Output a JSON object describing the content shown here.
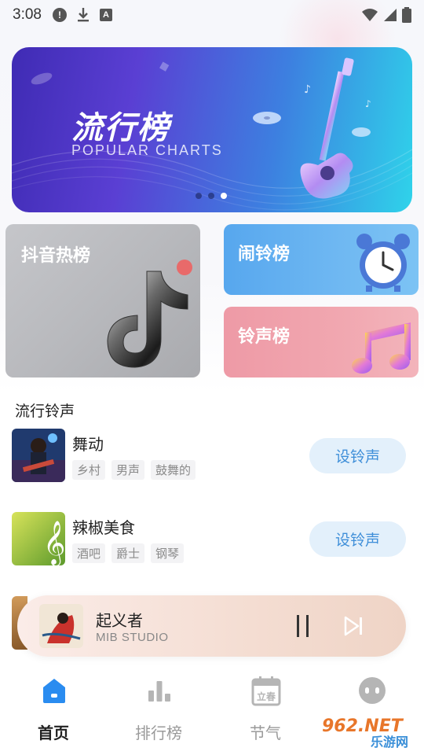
{
  "status_bar": {
    "time": "3:08",
    "icons": [
      "alert-icon",
      "download-icon",
      "a-icon",
      "wifi-icon",
      "signal-icon",
      "battery-icon"
    ],
    "a_glyph": "A",
    "alert_glyph": "!"
  },
  "banner": {
    "title": "流行榜",
    "subtitle": "POPULAR CHARTS",
    "carousel_pages": 3,
    "active_page": 3
  },
  "categories": {
    "douyin": "抖音热榜",
    "alarm": "闹铃榜",
    "ring": "铃声榜"
  },
  "section": {
    "title": "流行铃声"
  },
  "songs": [
    {
      "name": "舞动",
      "tags": [
        "乡村",
        "男声",
        "鼓舞的"
      ],
      "action": "设铃声"
    },
    {
      "name": "辣椒美食",
      "tags": [
        "酒吧",
        "爵士",
        "钢琴"
      ],
      "action": "设铃声"
    }
  ],
  "player": {
    "title": "起义者",
    "artist": "MIB STUDIO",
    "state": "playing"
  },
  "nav": {
    "items": [
      {
        "label": "首页",
        "icon": "home-icon",
        "active": true
      },
      {
        "label": "排行榜",
        "icon": "bar-chart-icon",
        "active": false
      },
      {
        "label": "节气",
        "icon": "calendar-icon",
        "active": false
      },
      {
        "label": "",
        "icon": "robot-icon",
        "active": false
      }
    ]
  },
  "calendar_glyph": "立春",
  "watermark": {
    "brand": "962.NET",
    "site": "乐游网"
  },
  "colors": {
    "accent_blue": "#3f8fd9",
    "home_active": "#2a8cf0",
    "nav_inactive": "#b5b5b5"
  }
}
